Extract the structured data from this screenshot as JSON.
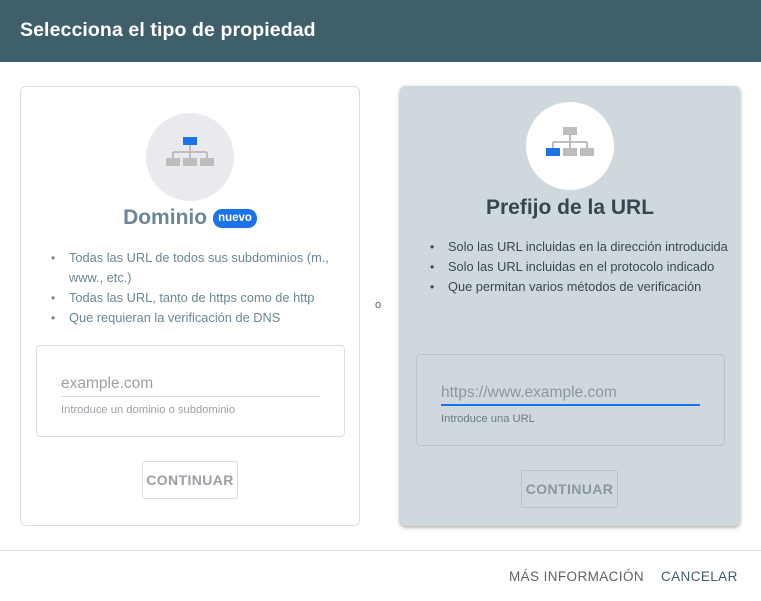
{
  "dialog": {
    "title": "Selecciona el tipo de propiedad"
  },
  "domain_card": {
    "icon": "sitemap-root-icon",
    "title": "Dominio",
    "badge": "nuevo",
    "bullets": [
      "Todas las URL de todos sus subdominios (m., www., etc.)",
      "Todas las URL, tanto de https como de http",
      "Que requieran la verificación de DNS"
    ],
    "input_value": "",
    "input_placeholder": "example.com",
    "input_hint": "Introduce un dominio o subdominio",
    "button_label": "CONTINUAR"
  },
  "separator": "o",
  "url_prefix_card": {
    "icon": "sitemap-branch-icon",
    "title": "Prefijo de la URL",
    "bullets": [
      "Solo las URL incluidas en la dirección introducida",
      "Solo las URL incluidas en el protocolo indicado",
      "Que permitan varios métodos de verificación"
    ],
    "input_value": "",
    "input_placeholder": "https://www.example.com",
    "input_hint": "Introduce una URL",
    "button_label": "CONTINUAR"
  },
  "footer": {
    "more_info_label": "MÁS INFORMACIÓN",
    "cancel_label": "CANCELAR"
  },
  "colors": {
    "header_bg": "#3f5f6b",
    "accent_blue": "#1a73e8",
    "selected_card_bg": "#cfd9dd"
  }
}
